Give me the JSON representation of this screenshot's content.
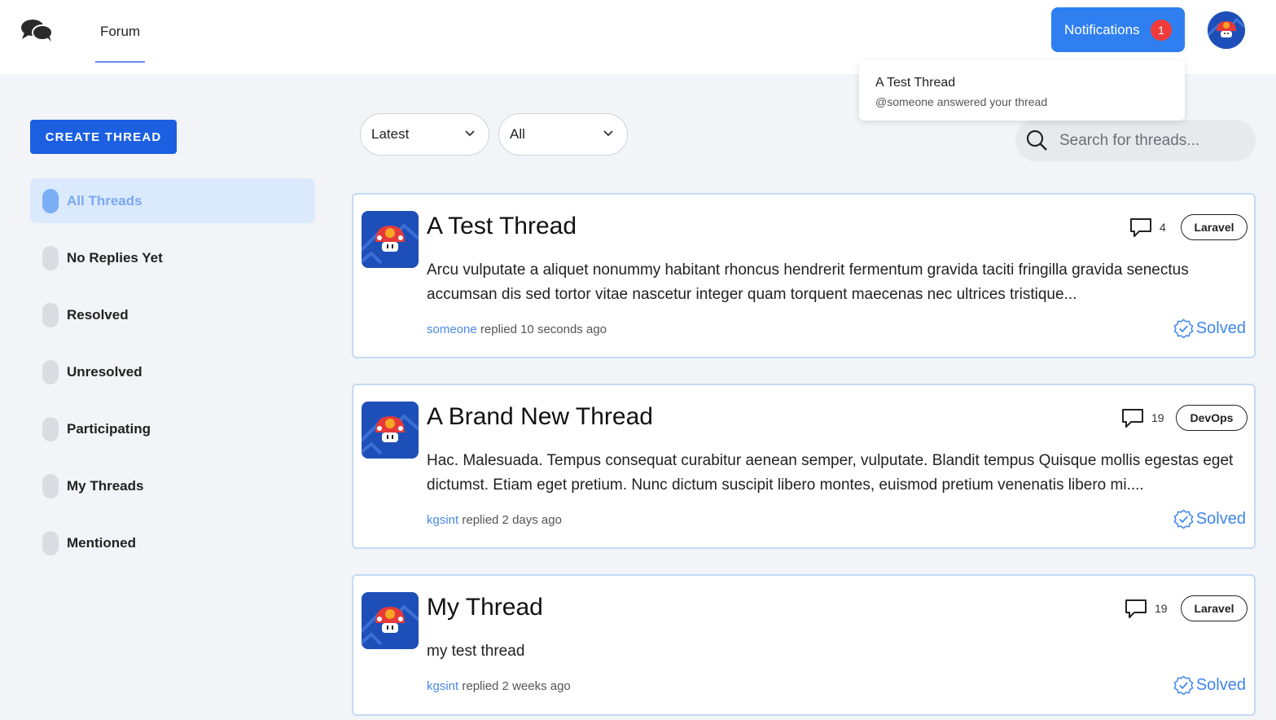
{
  "header": {
    "nav_forum": "Forum",
    "notifications_label": "Notifications",
    "notifications_count": "1"
  },
  "notification_dropdown": {
    "title": "A Test Thread",
    "subtitle": "@someone answered your thread"
  },
  "sidebar": {
    "create_label": "CREATE THREAD",
    "items": [
      {
        "label": "All Threads",
        "active": true
      },
      {
        "label": "No Replies Yet"
      },
      {
        "label": "Resolved"
      },
      {
        "label": "Unresolved"
      },
      {
        "label": "Participating"
      },
      {
        "label": "My Threads"
      },
      {
        "label": "Mentioned"
      }
    ]
  },
  "filters": {
    "sort_value": "Latest",
    "category_value": "All",
    "search_placeholder": "Search for threads..."
  },
  "threads": [
    {
      "title": "A Test Thread",
      "body": "Arcu vulputate a aliquet nonummy habitant rhoncus hendrerit fermentum gravida taciti fringilla gravida senectus accumsan dis sed tortor vitae nascetur integer quam torquent maecenas nec ultrices tristique...",
      "user": "someone",
      "replied": "replied 10 seconds ago",
      "replies": "4",
      "tag": "Laravel",
      "status": "Solved"
    },
    {
      "title": "A Brand New Thread",
      "body": "Hac. Malesuada. Tempus consequat curabitur aenean semper, vulputate. Blandit tempus Quisque mollis egestas eget dictumst. Etiam eget pretium. Nunc dictum suscipit libero montes, euismod pretium venenatis libero mi....",
      "user": "kgsint",
      "replied": "replied 2 days ago",
      "replies": "19",
      "tag": "DevOps",
      "status": "Solved"
    },
    {
      "title": "My Thread",
      "body": "my test thread",
      "user": "kgsint",
      "replied": "replied 2 weeks ago",
      "replies": "19",
      "tag": "Laravel",
      "status": "Solved"
    }
  ],
  "colors": {
    "primary": "#1c5fe0",
    "notification_button": "#2f7ff0",
    "badge": "#ef3b3b",
    "solved": "#3f86ec",
    "active_bg": "#dbe9fd"
  },
  "icons": [
    "chat-bubbles-icon",
    "chevron-down-icon",
    "search-icon",
    "comment-icon",
    "check-badge-icon",
    "mushroom-avatar-icon"
  ]
}
